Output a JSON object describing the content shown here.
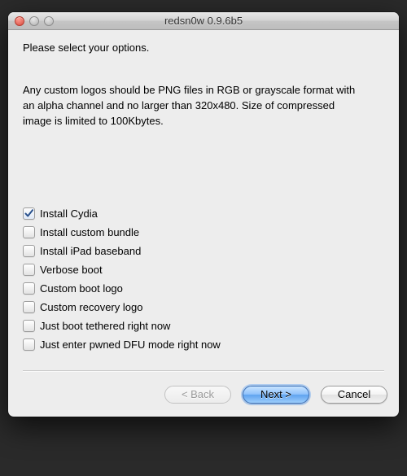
{
  "window": {
    "title": "redsn0w 0.9.6b5"
  },
  "heading": "Please select your options.",
  "note": "Any custom logos should be PNG files in RGB or grayscale format with an alpha channel and no larger than 320x480. Size of compressed image is limited to 100Kbytes.",
  "options": [
    {
      "label": "Install Cydia",
      "checked": true
    },
    {
      "label": "Install custom bundle",
      "checked": false
    },
    {
      "label": "Install iPad baseband",
      "checked": false
    },
    {
      "label": "Verbose boot",
      "checked": false
    },
    {
      "label": "Custom boot logo",
      "checked": false
    },
    {
      "label": "Custom recovery logo",
      "checked": false
    },
    {
      "label": "Just boot tethered right now",
      "checked": false
    },
    {
      "label": "Just enter pwned DFU mode right now",
      "checked": false
    }
  ],
  "buttons": {
    "back": "< Back",
    "next": "Next >",
    "cancel": "Cancel"
  }
}
